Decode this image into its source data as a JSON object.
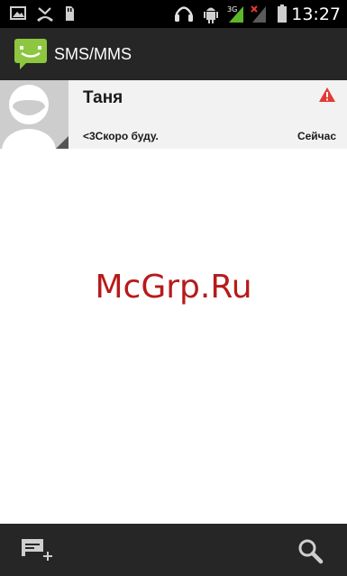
{
  "status_bar": {
    "time": "13:27",
    "network_label": "3G",
    "icons": [
      "image-notification-icon",
      "missed-call-icon",
      "sd-card-icon",
      "headset-icon",
      "android-debug-icon",
      "signal-3g-icon",
      "signal-no-sim-icon",
      "battery-icon"
    ]
  },
  "action_bar": {
    "title": "SMS/MMS",
    "icon": "messaging-app-icon",
    "accent_color": "#8dc63f"
  },
  "conversations": [
    {
      "name": "Таня",
      "snippet": "<3Скоро буду.",
      "time": "Сейчас",
      "status_icon": "warning-icon",
      "status_color": "#e53935",
      "avatar": "default-contact-avatar"
    }
  ],
  "watermark": {
    "text": "McGrp.Ru"
  },
  "bottom_bar": {
    "compose_icon": "new-message-icon",
    "search_icon": "search-icon"
  }
}
